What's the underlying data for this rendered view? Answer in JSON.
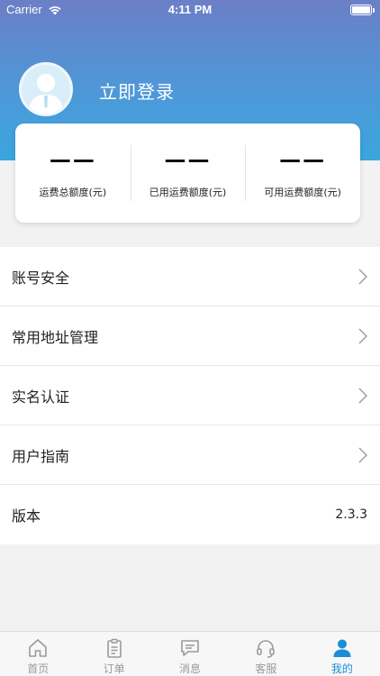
{
  "status_bar": {
    "carrier": "Carrier",
    "time": "4:11 PM"
  },
  "profile": {
    "login_label": "立即登录"
  },
  "quota": [
    {
      "value": "——",
      "label": "运费总额度(元)"
    },
    {
      "value": "——",
      "label": "已用运费额度(元)"
    },
    {
      "value": "——",
      "label": "可用运费额度(元)"
    }
  ],
  "menu": {
    "account_security": "账号安全",
    "address_management": "常用地址管理",
    "real_name_auth": "实名认证",
    "user_guide": "用户指南",
    "version_label": "版本",
    "version_value": "2.3.3"
  },
  "tabs": {
    "home": "首页",
    "orders": "订单",
    "messages": "消息",
    "service": "客服",
    "mine": "我的"
  },
  "colors": {
    "accent": "#1a8fd8",
    "header_top": "#6b7fc6",
    "header_bottom": "#3aa6dc"
  }
}
